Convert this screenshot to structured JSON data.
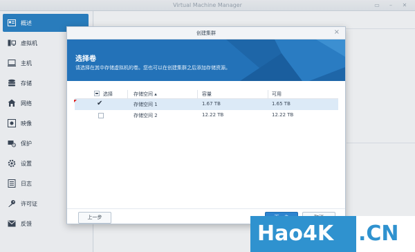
{
  "app": {
    "title": "Virtual Machine Manager"
  },
  "window_controls": {
    "pin": "▭",
    "minimize": "–",
    "close": "✕"
  },
  "sidebar": {
    "items": [
      {
        "label": "概述",
        "icon": "overview-icon",
        "active": true
      },
      {
        "label": "虚拟机",
        "icon": "virtual-machine-icon"
      },
      {
        "label": "主机",
        "icon": "host-icon"
      },
      {
        "label": "存储",
        "icon": "storage-icon"
      },
      {
        "label": "网络",
        "icon": "network-icon"
      },
      {
        "label": "映像",
        "icon": "image-icon"
      },
      {
        "label": "保护",
        "icon": "protection-icon"
      },
      {
        "label": "设置",
        "icon": "settings-icon"
      },
      {
        "label": "日志",
        "icon": "log-icon"
      },
      {
        "label": "许可证",
        "icon": "license-key-icon"
      },
      {
        "label": "反馈",
        "icon": "feedback-icon"
      }
    ]
  },
  "dialog": {
    "title": "创建集群",
    "close": "×",
    "banner_title": "选择卷",
    "banner_subtitle": "请选择在其中存储虚拟机的卷。您也可以在创建集群之后添加存储资源。",
    "table": {
      "headers": {
        "select": "选择",
        "name": "存储空间 ▴",
        "capacity": "容量",
        "available": "可用"
      },
      "rows": [
        {
          "checked": "✔",
          "name": "存储空间 1",
          "capacity": "1.67 TB",
          "available": "1.65 TB"
        },
        {
          "checked": "",
          "name": "存储空间 2",
          "capacity": "12.22 TB",
          "available": "12.22 TB"
        }
      ]
    },
    "buttons": {
      "prev": "上一步",
      "next": "下一步",
      "cancel": "取消"
    }
  },
  "watermark": {
    "left": "Hao4K",
    "right": ".CN"
  },
  "colors": {
    "accent": "#2a82c5",
    "banner": "#2372b8",
    "selected_row": "#dceaf7"
  }
}
